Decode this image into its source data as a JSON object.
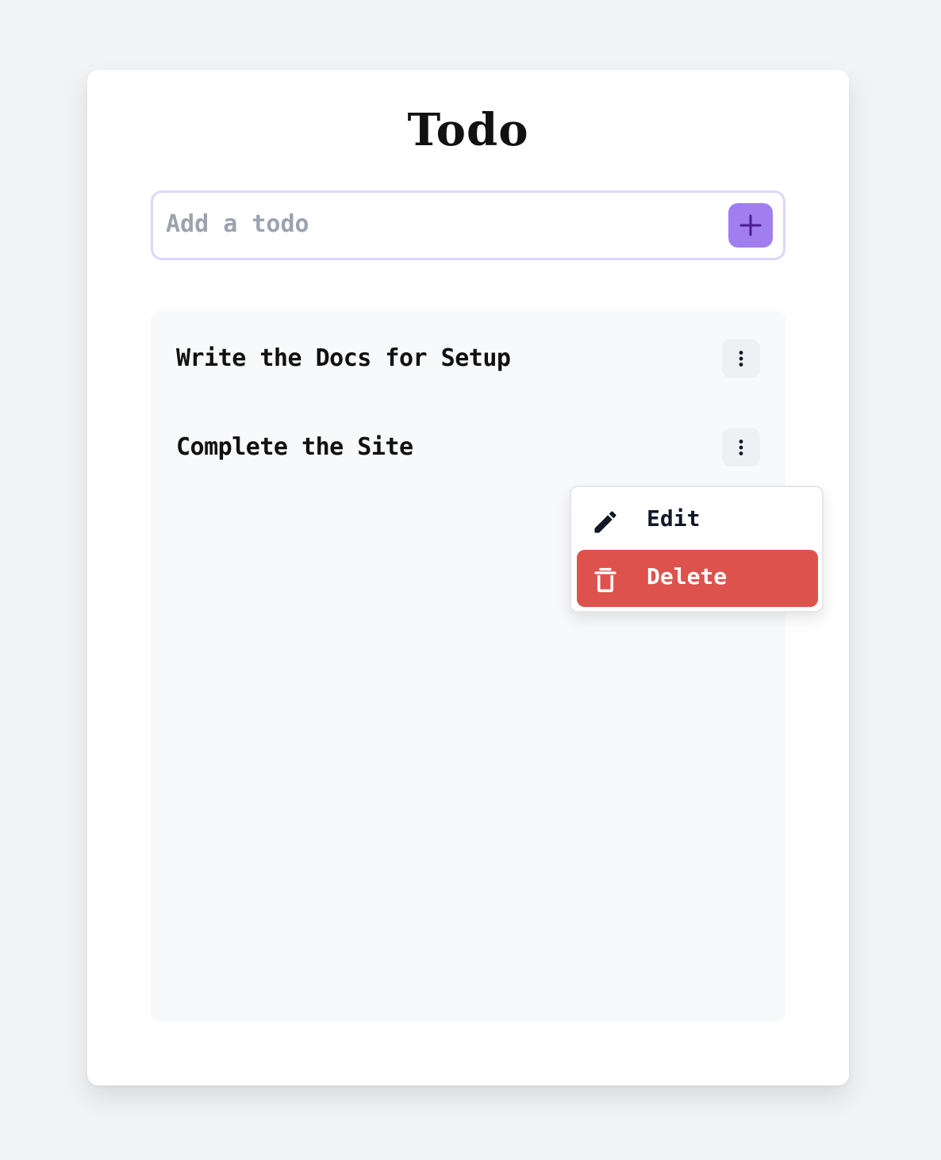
{
  "app": {
    "title": "Todo"
  },
  "add_form": {
    "placeholder": "Add a todo",
    "value": "",
    "add_button_icon": "plus-icon"
  },
  "todos": [
    {
      "text": "Write the Docs for Setup",
      "menu_icon": "more-vertical-icon"
    },
    {
      "text": "Complete the Site",
      "menu_icon": "more-vertical-icon"
    }
  ],
  "context_menu": {
    "open_for_item": "Complete the Site",
    "items": [
      {
        "label": "Edit",
        "icon": "pencil-icon"
      },
      {
        "label": "Delete",
        "icon": "trash-icon",
        "style": "danger"
      }
    ]
  },
  "colors": {
    "page_background": "#f2f3f5",
    "card_background": "#ffffff",
    "input_border": "#ddd6fe",
    "add_button": "#a07ef0",
    "add_button_icon": "#4c1d95",
    "list_background": "#f8f9fb",
    "danger": "#de524d",
    "text": "#111111",
    "placeholder": "#9ca3af"
  }
}
